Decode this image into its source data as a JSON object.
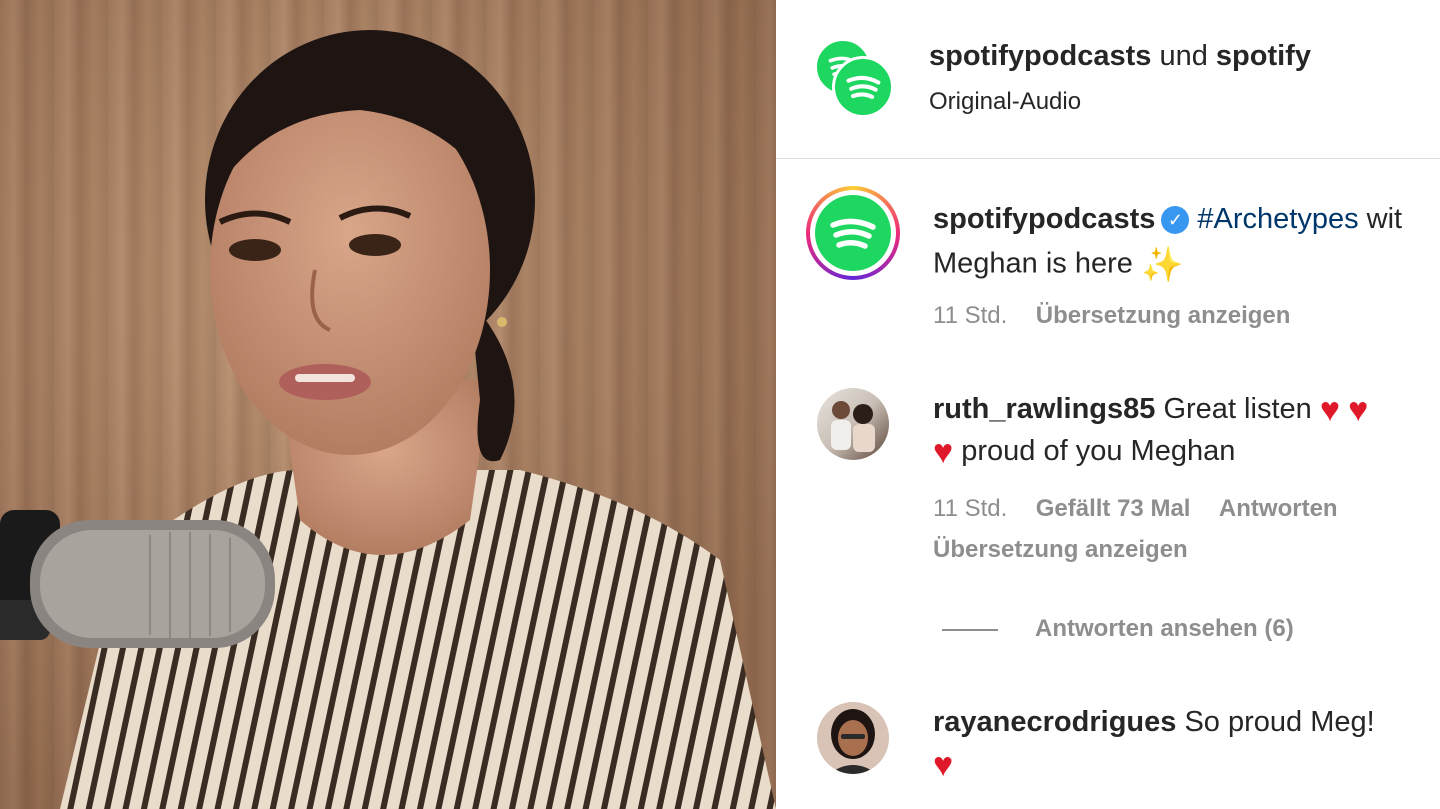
{
  "header": {
    "account_primary": "spotifypodcasts",
    "conjunction": "und",
    "account_secondary": "spotify",
    "audio_label": "Original-Audio"
  },
  "caption": {
    "username": "spotifypodcasts",
    "hashtag": "#Archetypes",
    "text_line1_tail": "wit",
    "text_line2": "Meghan is here",
    "time": "11 Std.",
    "translate": "Übersetzung anzeigen"
  },
  "comments": [
    {
      "username": "ruth_rawlings85",
      "text": "Great listen",
      "text_line2": "proud of you Meghan",
      "time": "11 Std.",
      "likes": "Gefällt 73 Mal",
      "reply": "Antworten",
      "translate": "Übersetzung anzeigen",
      "view_replies": "Antworten ansehen (6)"
    },
    {
      "username": "rayanecrodrigues",
      "text": "So proud Meg!"
    }
  ],
  "icons": {
    "brand": "spotify-logo-icon",
    "verified": "verified-badge-icon",
    "heart": "red-heart-emoji-icon",
    "sparkle": "sparkles-emoji-icon"
  },
  "colors": {
    "spotify_green": "#1ed760",
    "link_blue": "#00376b",
    "muted_gray": "#8e8e8e",
    "heart_red": "#e0192a"
  }
}
